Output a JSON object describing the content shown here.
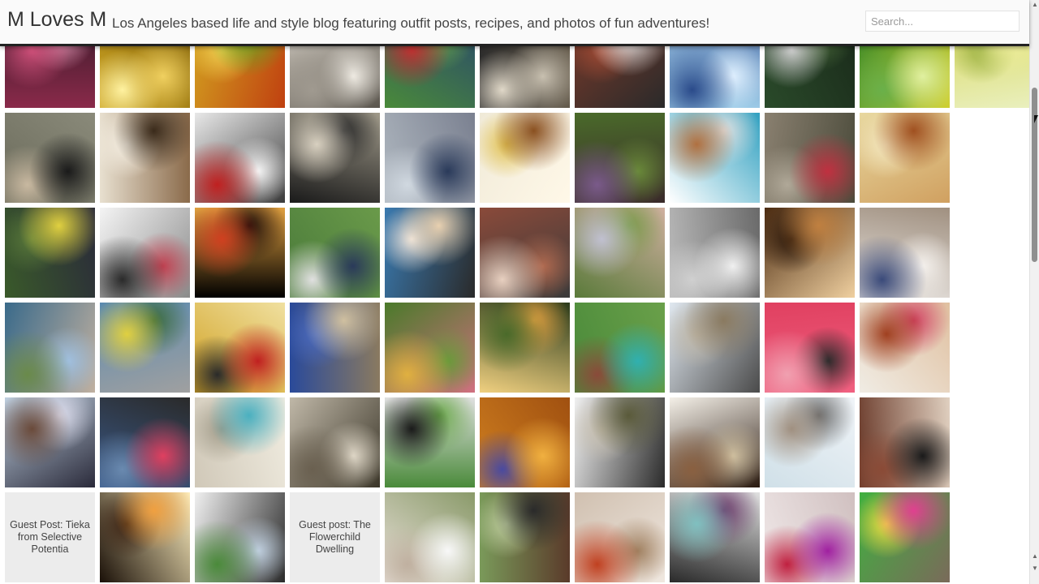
{
  "header": {
    "site_title": "M Loves M",
    "tagline": "Los Angeles based life and style blog featuring outfit posts, recipes, and photos of fun adventures!"
  },
  "search": {
    "placeholder": "Search..."
  },
  "grid": {
    "rows": [
      [
        {
          "kind": "photo",
          "icon": "floral-dress-photo",
          "colors": [
            "#8a2a4a",
            "#d0507a",
            "#f0a0c0",
            "#3a1a2a"
          ]
        },
        {
          "kind": "photo",
          "icon": "golden-food-photo",
          "colors": [
            "#c9a020",
            "#f0d060",
            "#fff2a0",
            "#8a6a10"
          ]
        },
        {
          "kind": "photo",
          "icon": "salad-photo",
          "colors": [
            "#d2a020",
            "#66a020",
            "#f0d050",
            "#c04010"
          ]
        },
        {
          "kind": "photo",
          "icon": "porch-outfit-photo",
          "colors": [
            "#d8d2c8",
            "#a09a90",
            "#f0ece4",
            "#5a554d"
          ]
        },
        {
          "kind": "photo",
          "icon": "red-skirt-outfit-photo",
          "colors": [
            "#4a8a3a",
            "#c03030",
            "#6aa84a",
            "#2a4a6a"
          ]
        },
        {
          "kind": "photo",
          "icon": "beach-portrait-photo",
          "colors": [
            "#2a2a2a",
            "#c8c0b0",
            "#e0d8c8",
            "#6a6050"
          ]
        },
        {
          "kind": "photo",
          "icon": "brick-wall-outfit-photo",
          "colors": [
            "#7a3a2a",
            "#f0f0f0",
            "#a04a34",
            "#2a2a2a"
          ]
        },
        {
          "kind": "photo",
          "icon": "blue-cardigan-photo",
          "colors": [
            "#a8d8f0",
            "#2a4a8a",
            "#e0f0ff",
            "#5a7ab0"
          ]
        },
        {
          "kind": "photo",
          "icon": "park-outfit-photo",
          "colors": [
            "#2a4a2a",
            "#d0d0d0",
            "#4a6a3a",
            "#1a2a1a"
          ]
        },
        {
          "kind": "photo",
          "icon": "shopping-bag-photo",
          "colors": [
            "#3a8a2a",
            "#e0f0a0",
            "#6ab04a",
            "#d0d030"
          ]
        },
        {
          "kind": "photo",
          "icon": "yellow-mug-photo",
          "colors": [
            "#d8d860",
            "#f0f0a0",
            "#9ab040",
            "#eaf0c0"
          ]
        }
      ],
      [
        {
          "kind": "photo",
          "icon": "man-reading-photo",
          "colors": [
            "#6a6a5a",
            "#1a1a1a",
            "#c8b8a0",
            "#8a8a7a"
          ]
        },
        {
          "kind": "photo",
          "icon": "pie-slice-photo",
          "colors": [
            "#e8e0d0",
            "#3a2a1a",
            "#f6f0e4",
            "#8a6a4a"
          ]
        },
        {
          "kind": "photo",
          "icon": "red-jacket-outfit-photo",
          "colors": [
            "#e8e8e8",
            "#c02020",
            "#f6f6f6",
            "#3a3a3a"
          ]
        },
        {
          "kind": "photo",
          "icon": "white-dog-photo",
          "colors": [
            "#1a1a1a",
            "#d8d0c0",
            "#2a2a2a",
            "#a09a8a"
          ]
        },
        {
          "kind": "photo",
          "icon": "grey-wall-outfit-photo",
          "colors": [
            "#b0b8c0",
            "#2a3a5a",
            "#d0d8e0",
            "#7a8090"
          ]
        },
        {
          "kind": "photo",
          "icon": "toffee-bar-photo",
          "colors": [
            "#f0ead8",
            "#8a5020",
            "#e0c050",
            "#fff8e8"
          ]
        },
        {
          "kind": "photo",
          "icon": "ivy-outfit-photo",
          "colors": [
            "#4a6a2a",
            "#7a5a8a",
            "#6a8a3a",
            "#3a2a2a"
          ]
        },
        {
          "kind": "photo",
          "icon": "blowfish-giveaway-photo",
          "colors": [
            "#ffffff",
            "#b07040",
            "#e0e0e0",
            "#30a0c0"
          ]
        },
        {
          "kind": "photo",
          "icon": "railroad-outfit-photo",
          "colors": [
            "#8a8070",
            "#c03040",
            "#b0a898",
            "#4a4a3a"
          ]
        },
        {
          "kind": "photo",
          "icon": "hair-portrait-photo",
          "colors": [
            "#e8d8a0",
            "#a05020",
            "#f4e8c0",
            "#d0a060"
          ]
        }
      ],
      [
        {
          "kind": "photo",
          "icon": "yellow-cardigan-photo",
          "colors": [
            "#3a5a2a",
            "#e0d040",
            "#5a7a3a",
            "#2a2a3a"
          ]
        },
        {
          "kind": "photo",
          "icon": "packing-list-photo",
          "colors": [
            "#f4f4f4",
            "#2a2a2a",
            "#c04050",
            "#8a8a8a"
          ]
        },
        {
          "kind": "photo",
          "icon": "fireworks-photo",
          "colors": [
            "#000000",
            "#d04020",
            "#1a0a08",
            "#e0a040"
          ]
        },
        {
          "kind": "photo",
          "icon": "denim-jacket-outfit-photo",
          "colors": [
            "#4a7a3a",
            "#2a3a5a",
            "#e0e0e0",
            "#6a9a4a"
          ]
        },
        {
          "kind": "photo",
          "icon": "sunglasses-dog-photo",
          "colors": [
            "#3a7ab0",
            "#e8d0b0",
            "#f0e8e0",
            "#2a2a2a"
          ]
        },
        {
          "kind": "photo",
          "icon": "brick-house-outfit-photo",
          "colors": [
            "#8a4a3a",
            "#e8d0c0",
            "#b06a50",
            "#3a3a3a"
          ]
        },
        {
          "kind": "photo",
          "icon": "garden-tee-outfit-photo",
          "colors": [
            "#5a7a3a",
            "#c0c0d0",
            "#7a9a4a",
            "#d0b0a0"
          ]
        },
        {
          "kind": "photo",
          "icon": "cloud-head-photo",
          "colors": [
            "#b8b8b8",
            "#f0f0f0",
            "#d0d0d0",
            "#6a6a6a"
          ]
        },
        {
          "kind": "photo",
          "icon": "shop-front-photo",
          "colors": [
            "#4a2a10",
            "#c08040",
            "#2a1608",
            "#f0d0a0"
          ]
        },
        {
          "kind": "photo",
          "icon": "denim-dress-outfit-photo",
          "colors": [
            "#e8e4e0",
            "#3a4a7a",
            "#f4f0ec",
            "#a09080"
          ]
        }
      ],
      [
        {
          "kind": "photo",
          "icon": "coastline-photo",
          "colors": [
            "#3a6a8a",
            "#6a8a4a",
            "#a0c0e0",
            "#c0b0a0"
          ]
        },
        {
          "kind": "photo",
          "icon": "coast-outfit-photo",
          "colors": [
            "#5a8ab0",
            "#e0d040",
            "#3a6a3a",
            "#a0a0a0"
          ]
        },
        {
          "kind": "photo",
          "icon": "cookbook-photo",
          "colors": [
            "#d0a020",
            "#c02020",
            "#2a2a2a",
            "#f0e0a0"
          ]
        },
        {
          "kind": "photo",
          "icon": "cathedral-photo",
          "colors": [
            "#2a4a9a",
            "#d0c0a0",
            "#4a6ac0",
            "#8a7a60"
          ]
        },
        {
          "kind": "photo",
          "icon": "lawn-outfit-photo",
          "colors": [
            "#4a7a2a",
            "#e0b040",
            "#6a9a3a",
            "#d07080"
          ]
        },
        {
          "kind": "photo",
          "icon": "sunset-field-photo",
          "colors": [
            "#f0d080",
            "#4a6a2a",
            "#e0a040",
            "#2a3a1a"
          ]
        },
        {
          "kind": "photo",
          "icon": "teal-top-outfit-photo",
          "colors": [
            "#4a8a3a",
            "#30b0b0",
            "#8a4a3a",
            "#6aa04a"
          ]
        },
        {
          "kind": "photo",
          "icon": "bell-tower-photo",
          "colors": [
            "#e0e8f0",
            "#8a7a60",
            "#c0b8a8",
            "#4a4a4a"
          ]
        },
        {
          "kind": "photo",
          "icon": "pink-laptop-photo",
          "colors": [
            "#e04060",
            "#f0a0b0",
            "#2a2a2a",
            "#f06080"
          ]
        },
        {
          "kind": "photo",
          "icon": "party-horn-photo",
          "colors": [
            "#f0ece4",
            "#a04020",
            "#d04060",
            "#e0c0a0"
          ]
        }
      ],
      [
        {
          "kind": "photo",
          "icon": "child-beach-photo",
          "colors": [
            "#c0d0e0",
            "#6a4a3a",
            "#e0e0f0",
            "#2a2a3a"
          ]
        },
        {
          "kind": "photo",
          "icon": "chambray-shirt-outfit-photo",
          "colors": [
            "#3a5a8a",
            "#e04060",
            "#6a8ab0",
            "#2a2a2a"
          ]
        },
        {
          "kind": "photo",
          "icon": "fountain-photo",
          "colors": [
            "#d0c8b8",
            "#4ab0c0",
            "#a09a88",
            "#f0ece0"
          ]
        },
        {
          "kind": "photo",
          "icon": "pantheon-photo",
          "colors": [
            "#c0b8a8",
            "#6a6050",
            "#e0d8c8",
            "#3a3528"
          ]
        },
        {
          "kind": "photo",
          "icon": "black-dress-photo",
          "colors": [
            "#4a8a3a",
            "#1a1a1a",
            "#6aa84a",
            "#e0e0e0"
          ]
        },
        {
          "kind": "photo",
          "icon": "blueberry-pancake-photo",
          "colors": [
            "#d08020",
            "#f0b040",
            "#4a4aa0",
            "#a05010"
          ]
        },
        {
          "kind": "photo",
          "icon": "porch-olive-outfit-photo",
          "colors": [
            "#f0f0f0",
            "#5a5a3a",
            "#c8c0b0",
            "#2a2a2a"
          ]
        },
        {
          "kind": "photo",
          "icon": "tiramisu-photo",
          "colors": [
            "#f4f0e8",
            "#8a6040",
            "#d0c0a0",
            "#2a1a10"
          ]
        },
        {
          "kind": "photo",
          "icon": "desert-road-photo",
          "colors": [
            "#d0e0e8",
            "#a09080",
            "#6a6a6a",
            "#f0f4f8"
          ]
        },
        {
          "kind": "photo",
          "icon": "brick-black-dress-photo",
          "colors": [
            "#6a3a2a",
            "#1a1a1a",
            "#8a4a36",
            "#e0d0c0"
          ]
        }
      ],
      [
        {
          "kind": "text",
          "title_lines": [
            "Guest Post: Tieka",
            "from Selective",
            "Potentia"
          ]
        },
        {
          "kind": "photo",
          "icon": "candles-photo",
          "colors": [
            "#1a1008",
            "#f0a040",
            "#3a2010",
            "#fff0c0"
          ]
        },
        {
          "kind": "photo",
          "icon": "couple-photo",
          "colors": [
            "#f0f0f0",
            "#4a8a3a",
            "#c0d0e0",
            "#2a2a2a"
          ]
        },
        {
          "kind": "text",
          "title_lines": [
            "Guest post: The",
            "Flowerchild",
            "Dwelling"
          ]
        },
        {
          "kind": "photo",
          "icon": "bouquet-photo",
          "colors": [
            "#e8e0d8",
            "#f8f8f8",
            "#c0b0a0",
            "#8a9a6a"
          ]
        },
        {
          "kind": "photo",
          "icon": "horse-photo",
          "colors": [
            "#7a9a5a",
            "#2a2a2a",
            "#c0d0a0",
            "#5a3a2a"
          ]
        },
        {
          "kind": "photo",
          "icon": "lace-up-boots-photo",
          "colors": [
            "#d0c0b0",
            "#c04020",
            "#a08060",
            "#f0e8e0"
          ]
        },
        {
          "kind": "photo",
          "icon": "record-player-photo",
          "colors": [
            "#2a2a2a",
            "#80c0c0",
            "#6a3a6a",
            "#e0e0e0"
          ]
        },
        {
          "kind": "photo",
          "icon": "purple-top-outfit-photo",
          "colors": [
            "#f0e8e8",
            "#a020a0",
            "#c02040",
            "#d0c0c0"
          ]
        },
        {
          "kind": "photo",
          "icon": "easter-eggs-photo",
          "colors": [
            "#40b040",
            "#e04090",
            "#f0e040",
            "#7a6a5a"
          ]
        }
      ]
    ]
  }
}
